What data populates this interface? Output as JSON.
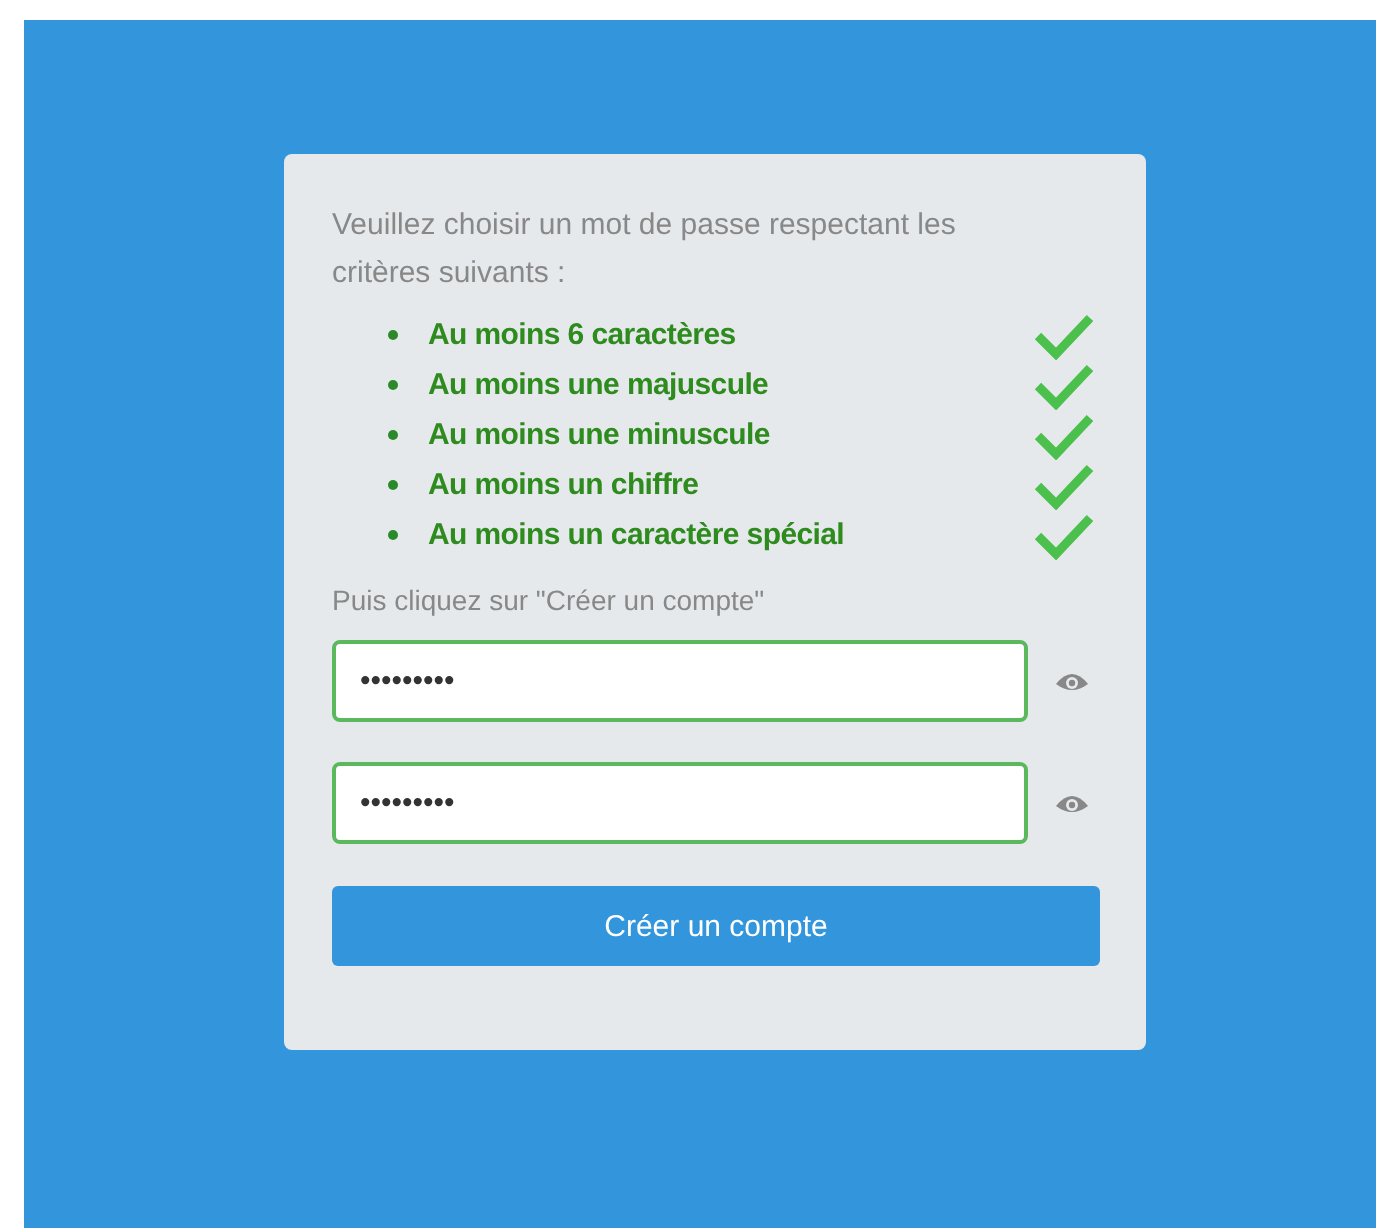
{
  "intro": "Veuillez choisir un mot de passe respectant les critères suivants :",
  "criteria": [
    {
      "label": "Au moins 6 caractères",
      "met": true
    },
    {
      "label": "Au moins une majuscule",
      "met": true
    },
    {
      "label": "Au moins une minuscule",
      "met": true
    },
    {
      "label": "Au moins un chiffre",
      "met": true
    },
    {
      "label": "Au moins un caractère spécial",
      "met": true
    }
  ],
  "instruction": "Puis cliquez sur \"Créer un compte\"",
  "fields": [
    {
      "value": "•••••••••",
      "valid": true
    },
    {
      "value": "•••••••••",
      "valid": true
    }
  ],
  "button": "Créer un compte"
}
